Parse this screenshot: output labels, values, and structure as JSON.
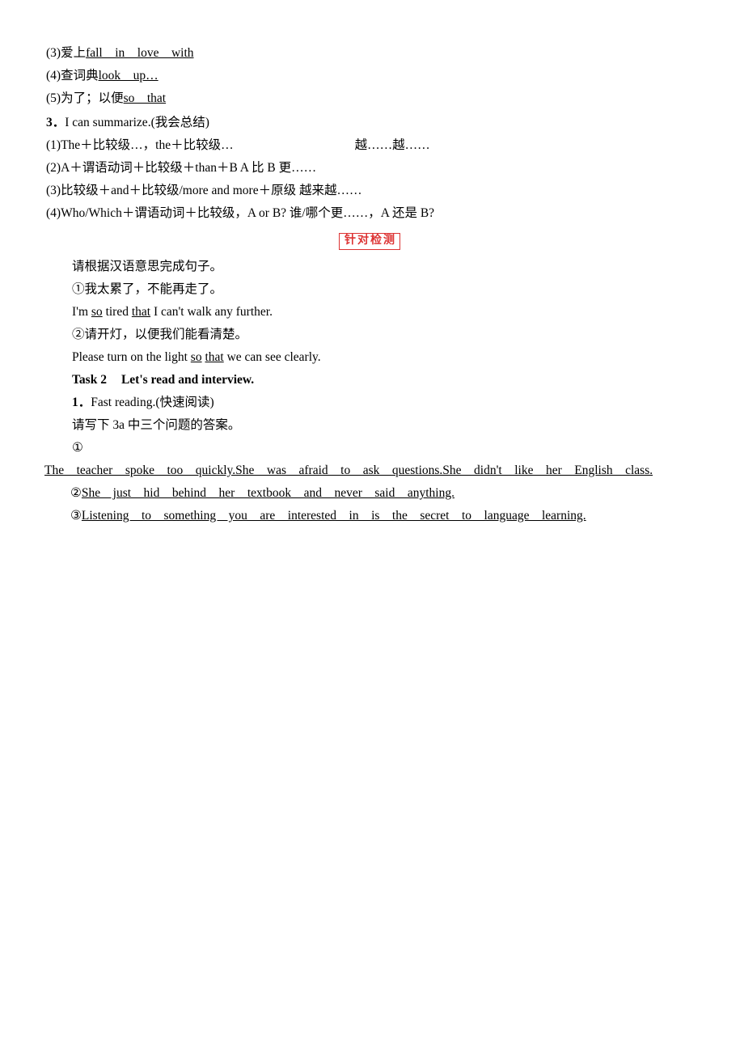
{
  "document": {
    "section_phrases": {
      "item3": {
        "prefix": "(3)爱上",
        "answer": "fall　in　love　with"
      },
      "item4": {
        "prefix": "(4)查词典",
        "answer": "look　up…"
      },
      "item5": {
        "prefix": "(5)为了；以便",
        "answer": "so　that"
      }
    },
    "summarize": {
      "number": "3",
      "title": "I can summarize.(我会总结)",
      "items": [
        {
          "left": "(1)The＋比较级…，the＋比较级…",
          "right": "越……越……"
        },
        {
          "left": "(2)A＋谓语动词＋比较级＋than＋B  A 比 B 更……",
          "right": ""
        },
        {
          "left": "(3)比较级＋and＋比较级/more and more＋原级  越来越……",
          "right": ""
        },
        {
          "left": "(4)Who/Which＋谓语动词＋比较级，A or B?  谁/哪个更……，A 还是 B?",
          "right": ""
        }
      ]
    },
    "seal": {
      "text": "针对检测"
    },
    "practice": {
      "instruction": "请根据汉语意思完成句子。",
      "q1_cn": "①我太累了，不能再走了。",
      "a1": {
        "pre": "I'm ",
        "u1": "so",
        "mid": " tired ",
        "u2": "that",
        "post": " I can't walk any further."
      },
      "q2_cn": "②请开灯，以便我们能看清楚。",
      "a2": {
        "pre": "Please turn on the light ",
        "u1": "so",
        "mid": " ",
        "u2": "that",
        "post": " we can see clearly."
      }
    },
    "task2": {
      "label": "Task 2",
      "title": "Let's read and interview.",
      "sub_number": "1",
      "sub_title": "Fast reading.(快速阅读)",
      "instruction": "请写下 3a 中三个问题的答案。",
      "marker1": "①",
      "answer1": "The　teacher　spoke　too　quickly.She　was　afraid　to　ask　questions.She　didn't　like　her　English　class.",
      "answer2_marker": "②",
      "answer2": "She　just　hid　behind　her　textbook　and　never　said　anything.",
      "answer3_marker": "③",
      "answer3": "Listening　to　something　you　are　interested　in　is　the　secret　to　language　learning."
    }
  }
}
